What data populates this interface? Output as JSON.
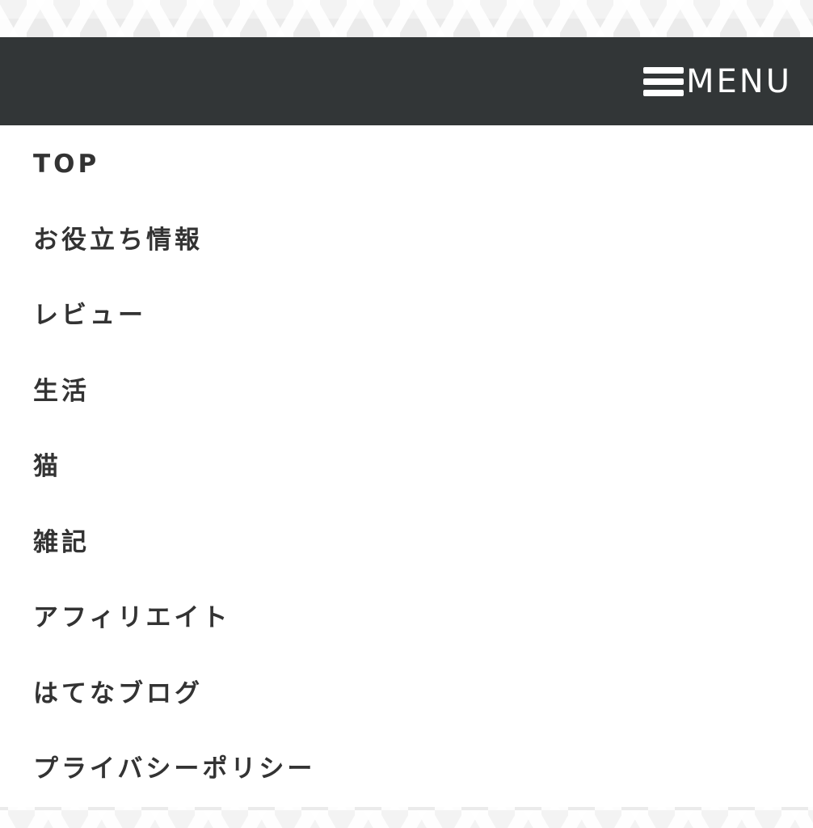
{
  "header": {
    "menu_label": "MENU"
  },
  "nav": {
    "items": [
      {
        "label": "TOP"
      },
      {
        "label": "お役立ち情報"
      },
      {
        "label": "レビュー"
      },
      {
        "label": "生活"
      },
      {
        "label": "猫"
      },
      {
        "label": "雑記"
      },
      {
        "label": "アフィリエイト"
      },
      {
        "label": "はてなブログ"
      },
      {
        "label": "プライバシーポリシー"
      }
    ]
  },
  "colors": {
    "header_bg": "#323637",
    "menu_text": "#ffffff",
    "nav_bg": "#ffffff",
    "nav_text": "#333333",
    "pattern_bg": "#f3f3f3"
  },
  "icons": {
    "menu_toggle": "hamburger-icon"
  }
}
